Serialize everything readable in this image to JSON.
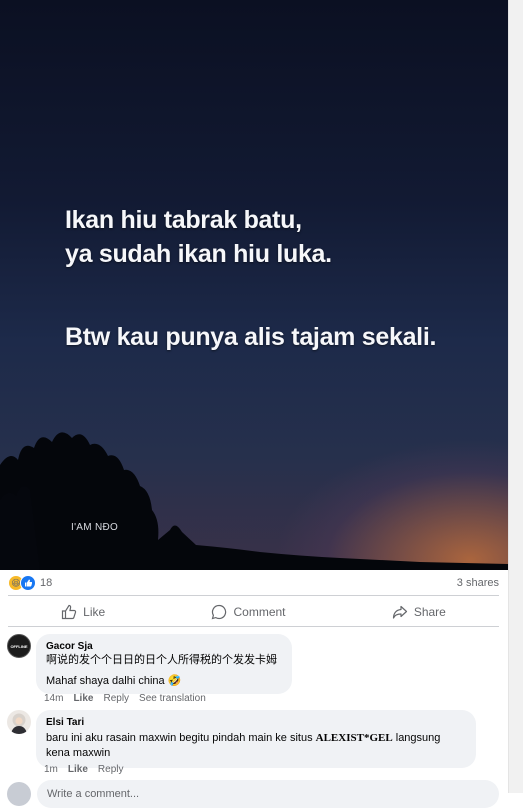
{
  "post_image": {
    "line1": "Ikan hiu tabrak batu,\nya sudah ikan hiu luka.",
    "line2": "Btw kau punya alis tajam sekali.",
    "watermark": "I'AM NÐO"
  },
  "reactions": {
    "count": "18",
    "shares": "3 shares",
    "icons": [
      "haha-emoji-icon",
      "like-icon"
    ]
  },
  "actions": {
    "like": "Like",
    "comment": "Comment",
    "share": "Share"
  },
  "comments": [
    {
      "name": "Gacor Sja",
      "text_line1": "啊说的发个个日日的日个人所得税的个发发卡姆",
      "text_line2": "Mahaf shaya dalhi china 🤣",
      "time": "14m",
      "like": "Like",
      "reply": "Reply",
      "translate": "See translation",
      "avatar_text": "OFFLINE"
    },
    {
      "name": "Elsi Tari",
      "text_before": "baru ini aku rasain maxwin begitu pindah main ke situs ",
      "text_bold": "ALEXIST*GEL",
      "text_after": " langsung kena maxwin",
      "time": "1m",
      "like": "Like",
      "reply": "Reply"
    }
  ],
  "write_comment": {
    "placeholder": "Write a comment..."
  },
  "colors": {
    "accent": "#1877f2",
    "muted": "#65676b",
    "bubble": "#f0f2f5"
  }
}
